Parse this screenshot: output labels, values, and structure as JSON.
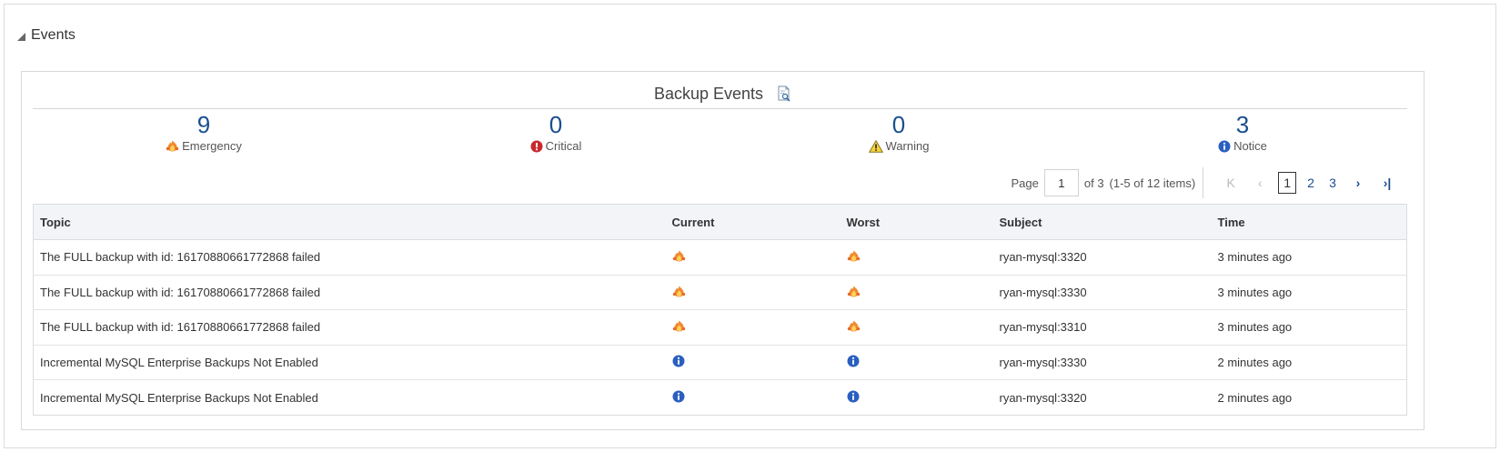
{
  "section": {
    "title": "Events",
    "toggle_icon": "collapse-triangle-icon"
  },
  "panel": {
    "title": "Backup Events",
    "title_icon": "report-icon"
  },
  "summary": [
    {
      "count": "9",
      "label": "Emergency",
      "icon": "emergency-flame-icon"
    },
    {
      "count": "0",
      "label": "Critical",
      "icon": "critical-icon"
    },
    {
      "count": "0",
      "label": "Warning",
      "icon": "warning-icon"
    },
    {
      "count": "3",
      "label": "Notice",
      "icon": "info-icon"
    }
  ],
  "pager": {
    "page_label": "Page",
    "page_value": "1",
    "of_label": "of 3",
    "items_label": "(1-5 of 12 items)",
    "pages": [
      "1",
      "2",
      "3"
    ],
    "current_page": "1"
  },
  "table": {
    "columns": [
      "Topic",
      "Current",
      "Worst",
      "Subject",
      "Time"
    ],
    "rows": [
      {
        "topic": "The FULL backup with id: 16170880661772868 failed",
        "current": "emergency",
        "worst": "emergency",
        "subject": "ryan-mysql:3320",
        "time": "3 minutes ago"
      },
      {
        "topic": "The FULL backup with id: 16170880661772868 failed",
        "current": "emergency",
        "worst": "emergency",
        "subject": "ryan-mysql:3330",
        "time": "3 minutes ago"
      },
      {
        "topic": "The FULL backup with id: 16170880661772868 failed",
        "current": "emergency",
        "worst": "emergency",
        "subject": "ryan-mysql:3310",
        "time": "3 minutes ago"
      },
      {
        "topic": "Incremental MySQL Enterprise Backups Not Enabled",
        "current": "notice",
        "worst": "notice",
        "subject": "ryan-mysql:3330",
        "time": "2 minutes ago"
      },
      {
        "topic": "Incremental MySQL Enterprise Backups Not Enabled",
        "current": "notice",
        "worst": "notice",
        "subject": "ryan-mysql:3320",
        "time": "2 minutes ago"
      }
    ]
  },
  "colors": {
    "accent": "#1a4f8f",
    "header_bg": "#f2f4f8",
    "border": "#dcdcdc"
  }
}
